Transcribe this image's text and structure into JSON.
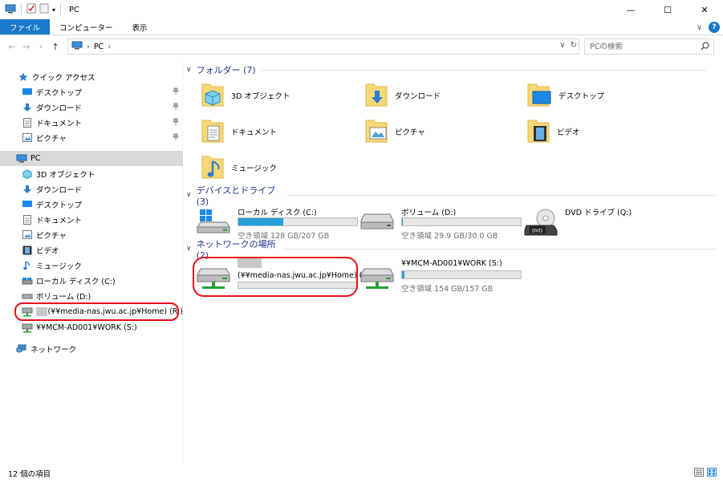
{
  "window": {
    "title": "PC",
    "minimize": "—",
    "maximize": "☐",
    "close": "✕"
  },
  "ribbon": {
    "tabs": [
      "ファイル",
      "コンピューター",
      "表示"
    ],
    "expand": "∨",
    "help": "?"
  },
  "address": {
    "path": "PC",
    "search_placeholder": "PCの検索"
  },
  "sidebar": {
    "quick_access": "クイック アクセス",
    "quick_items": [
      "デスクトップ",
      "ダウンロード",
      "ドキュメント",
      "ピクチャ"
    ],
    "pc": "PC",
    "pc_items": [
      "3D オブジェクト",
      "ダウンロード",
      "デスクトップ",
      "ドキュメント",
      "ピクチャ",
      "ビデオ",
      "ミュージック",
      "ローカル ディスク (C:)",
      "ボリューム (D:)",
      "(¥¥media-nas.jwu.ac.jp¥Home) (R:)",
      "¥¥MCM-AD001¥WORK (S:)"
    ],
    "network": "ネットワーク"
  },
  "main": {
    "folders_header": "フォルダー (7)",
    "folders": [
      "3D オブジェクト",
      "ダウンロード",
      "デスクトップ",
      "ドキュメント",
      "ピクチャ",
      "ビデオ",
      "ミュージック"
    ],
    "drives_header": "デバイスとドライブ (3)",
    "drives": [
      {
        "name": "ローカル ディスク (C:)",
        "free": "空き領域 128 GB/207 GB",
        "used_fraction": 0.38
      },
      {
        "name": "ボリューム (D:)",
        "free": "空き領域 29.9 GB/30.0 GB",
        "used_fraction": 0.005
      },
      {
        "name": "DVD ドライブ (Q:)"
      }
    ],
    "network_header": "ネットワークの場所 (2)",
    "network_drives": [
      {
        "name": "(¥¥media-nas.jwu.ac.jp¥Home) (R:)",
        "used_fraction": 0
      },
      {
        "name": "¥¥MCM-AD001¥WORK (S:)",
        "free": "空き領域 154 GB/157 GB",
        "used_fraction": 0.02
      }
    ]
  },
  "status": {
    "count": "12 個の項目"
  },
  "colors": {
    "accent": "#1979ca",
    "highlight": "#e8101b",
    "bar_fill": "#26a0da",
    "header_text": "#1e3287"
  }
}
